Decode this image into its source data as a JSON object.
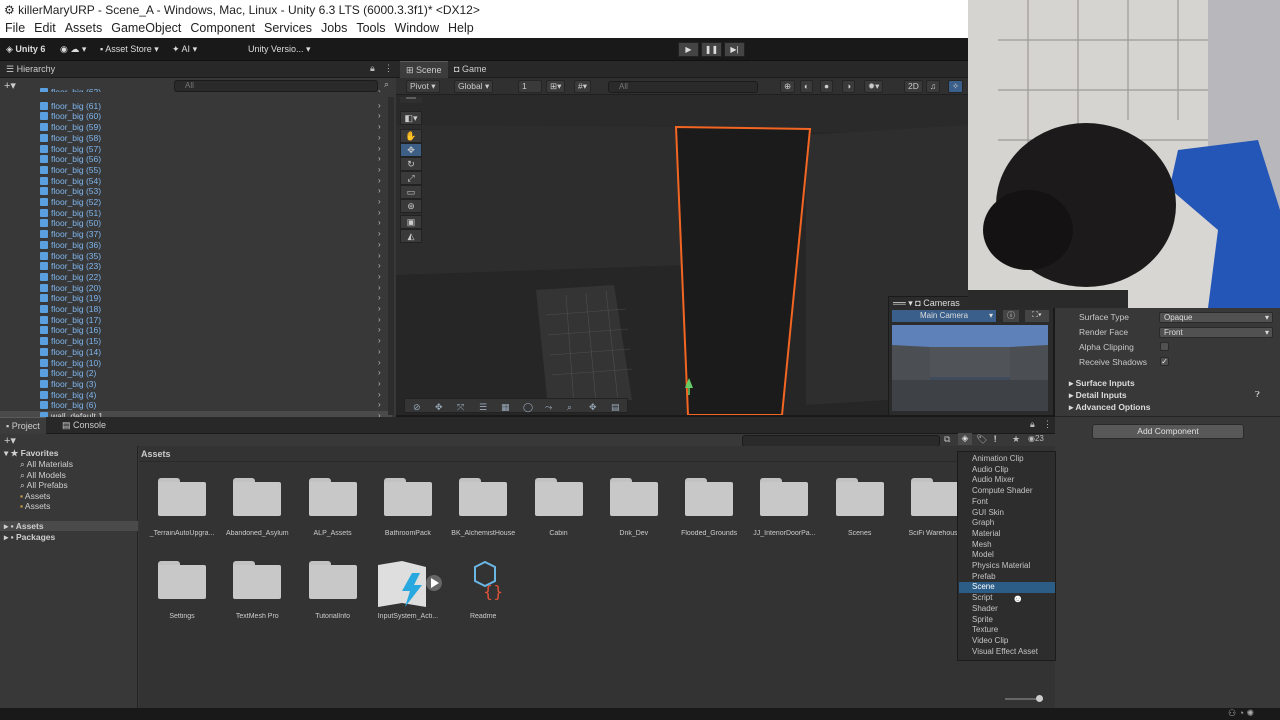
{
  "window": {
    "title": "killerMaryURP - Scene_A - Windows, Mac, Linux - Unity 6.3 LTS (6000.3.3f1)* <DX12>"
  },
  "menu": [
    "File",
    "Edit",
    "Assets",
    "GameObject",
    "Component",
    "Services",
    "Jobs",
    "Tools",
    "Window",
    "Help"
  ],
  "toolbar": {
    "account": "Unity 6",
    "asset_store": "Asset Store",
    "ai": "AI",
    "version_control": "Unity Versio..."
  },
  "hierarchy": {
    "tab": "Hierarchy",
    "search_placeholder": "All",
    "items": [
      "floor_big (62)",
      "floor_big (61)",
      "floor_big (60)",
      "floor_big (59)",
      "floor_big (58)",
      "floor_big (57)",
      "floor_big (56)",
      "floor_big (55)",
      "floor_big (54)",
      "floor_big (53)",
      "floor_big (52)",
      "floor_big (51)",
      "floor_big (50)",
      "floor_big (37)",
      "floor_big (36)",
      "floor_big (35)",
      "floor_big (23)",
      "floor_big (22)",
      "floor_big (20)",
      "floor_big (19)",
      "floor_big (18)",
      "floor_big (17)",
      "floor_big (16)",
      "floor_big (15)",
      "floor_big (14)",
      "floor_big (10)",
      "floor_big (2)",
      "floor_big (3)",
      "floor_big (4)",
      "floor_big (6)",
      "wall_default 1"
    ]
  },
  "scene": {
    "tabs": [
      "Scene",
      "Game"
    ],
    "pivot": "Pivot",
    "global": "Global",
    "grid_value": "1",
    "search_placeholder": "All",
    "cameras_overlay": {
      "title": "Cameras",
      "selected": "Main Camera"
    }
  },
  "inspector": {
    "rows": [
      {
        "label": "Surface Type",
        "value": "Opaque"
      },
      {
        "label": "Render Face",
        "value": "Front"
      }
    ],
    "checks": [
      {
        "label": "Alpha Clipping",
        "checked": ""
      },
      {
        "label": "Receive Shadows",
        "checked": "✓"
      }
    ],
    "sections": [
      "Surface Inputs",
      "Detail Inputs",
      "Advanced Options"
    ],
    "add_component": "Add Component"
  },
  "project": {
    "tabs": [
      "Project",
      "Console"
    ],
    "breadcrumb": "Assets",
    "hidden_count": "23",
    "favorites": {
      "title": "Favorites",
      "items": [
        "All Materials",
        "All Models",
        "All Prefabs",
        "Assets",
        "Assets"
      ]
    },
    "roots": [
      "Assets",
      "Packages"
    ],
    "assets": [
      "_TerrainAutoUpgra...",
      "Abandoned_Asylum",
      "ALP_Assets",
      "BathroomPack",
      "BK_AlchemistHouse",
      "Cabin",
      "Dnk_Dev",
      "Flooded_Grounds",
      "JJ_InteriorDoorPa...",
      "Scenes",
      "SciFi Warehouse",
      "Settings",
      "TextMesh Pro",
      "TutorialInfo",
      "InputSystem_Acti...",
      "Readme"
    ],
    "type_filter": [
      "Animation Clip",
      "Audio Clip",
      "Audio Mixer",
      "Compute Shader",
      "Font",
      "GUI Skin",
      "Graph",
      "Material",
      "Mesh",
      "Model",
      "Physics Material",
      "Prefab",
      "Scene",
      "Script",
      "Shader",
      "Sprite",
      "Texture",
      "Video Clip",
      "Visual Effect Asset"
    ],
    "type_filter_selected": "Scene"
  },
  "colors": {
    "selection": "#2c5d87",
    "outline": "#f26522",
    "hierarchy_text": "#7fb6ee"
  }
}
